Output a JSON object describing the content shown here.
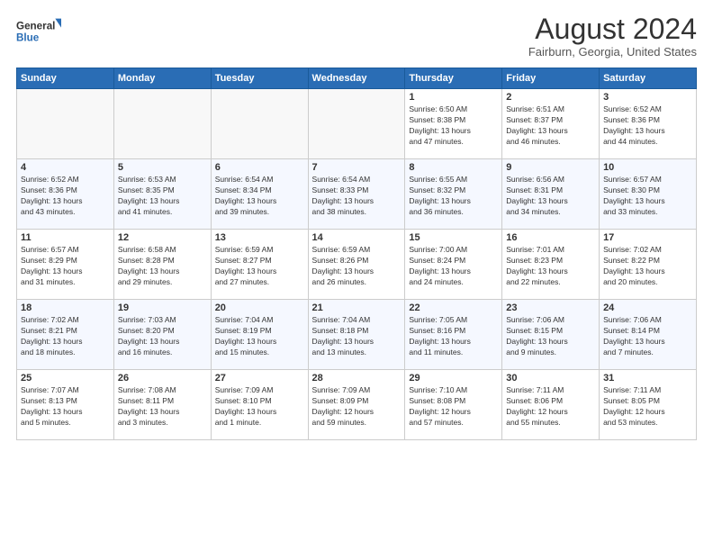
{
  "header": {
    "logo_line1": "General",
    "logo_line2": "Blue",
    "title": "August 2024",
    "subtitle": "Fairburn, Georgia, United States"
  },
  "weekdays": [
    "Sunday",
    "Monday",
    "Tuesday",
    "Wednesday",
    "Thursday",
    "Friday",
    "Saturday"
  ],
  "weeks": [
    [
      {
        "day": "",
        "info": ""
      },
      {
        "day": "",
        "info": ""
      },
      {
        "day": "",
        "info": ""
      },
      {
        "day": "",
        "info": ""
      },
      {
        "day": "1",
        "info": "Sunrise: 6:50 AM\nSunset: 8:38 PM\nDaylight: 13 hours\nand 47 minutes."
      },
      {
        "day": "2",
        "info": "Sunrise: 6:51 AM\nSunset: 8:37 PM\nDaylight: 13 hours\nand 46 minutes."
      },
      {
        "day": "3",
        "info": "Sunrise: 6:52 AM\nSunset: 8:36 PM\nDaylight: 13 hours\nand 44 minutes."
      }
    ],
    [
      {
        "day": "4",
        "info": "Sunrise: 6:52 AM\nSunset: 8:36 PM\nDaylight: 13 hours\nand 43 minutes."
      },
      {
        "day": "5",
        "info": "Sunrise: 6:53 AM\nSunset: 8:35 PM\nDaylight: 13 hours\nand 41 minutes."
      },
      {
        "day": "6",
        "info": "Sunrise: 6:54 AM\nSunset: 8:34 PM\nDaylight: 13 hours\nand 39 minutes."
      },
      {
        "day": "7",
        "info": "Sunrise: 6:54 AM\nSunset: 8:33 PM\nDaylight: 13 hours\nand 38 minutes."
      },
      {
        "day": "8",
        "info": "Sunrise: 6:55 AM\nSunset: 8:32 PM\nDaylight: 13 hours\nand 36 minutes."
      },
      {
        "day": "9",
        "info": "Sunrise: 6:56 AM\nSunset: 8:31 PM\nDaylight: 13 hours\nand 34 minutes."
      },
      {
        "day": "10",
        "info": "Sunrise: 6:57 AM\nSunset: 8:30 PM\nDaylight: 13 hours\nand 33 minutes."
      }
    ],
    [
      {
        "day": "11",
        "info": "Sunrise: 6:57 AM\nSunset: 8:29 PM\nDaylight: 13 hours\nand 31 minutes."
      },
      {
        "day": "12",
        "info": "Sunrise: 6:58 AM\nSunset: 8:28 PM\nDaylight: 13 hours\nand 29 minutes."
      },
      {
        "day": "13",
        "info": "Sunrise: 6:59 AM\nSunset: 8:27 PM\nDaylight: 13 hours\nand 27 minutes."
      },
      {
        "day": "14",
        "info": "Sunrise: 6:59 AM\nSunset: 8:26 PM\nDaylight: 13 hours\nand 26 minutes."
      },
      {
        "day": "15",
        "info": "Sunrise: 7:00 AM\nSunset: 8:24 PM\nDaylight: 13 hours\nand 24 minutes."
      },
      {
        "day": "16",
        "info": "Sunrise: 7:01 AM\nSunset: 8:23 PM\nDaylight: 13 hours\nand 22 minutes."
      },
      {
        "day": "17",
        "info": "Sunrise: 7:02 AM\nSunset: 8:22 PM\nDaylight: 13 hours\nand 20 minutes."
      }
    ],
    [
      {
        "day": "18",
        "info": "Sunrise: 7:02 AM\nSunset: 8:21 PM\nDaylight: 13 hours\nand 18 minutes."
      },
      {
        "day": "19",
        "info": "Sunrise: 7:03 AM\nSunset: 8:20 PM\nDaylight: 13 hours\nand 16 minutes."
      },
      {
        "day": "20",
        "info": "Sunrise: 7:04 AM\nSunset: 8:19 PM\nDaylight: 13 hours\nand 15 minutes."
      },
      {
        "day": "21",
        "info": "Sunrise: 7:04 AM\nSunset: 8:18 PM\nDaylight: 13 hours\nand 13 minutes."
      },
      {
        "day": "22",
        "info": "Sunrise: 7:05 AM\nSunset: 8:16 PM\nDaylight: 13 hours\nand 11 minutes."
      },
      {
        "day": "23",
        "info": "Sunrise: 7:06 AM\nSunset: 8:15 PM\nDaylight: 13 hours\nand 9 minutes."
      },
      {
        "day": "24",
        "info": "Sunrise: 7:06 AM\nSunset: 8:14 PM\nDaylight: 13 hours\nand 7 minutes."
      }
    ],
    [
      {
        "day": "25",
        "info": "Sunrise: 7:07 AM\nSunset: 8:13 PM\nDaylight: 13 hours\nand 5 minutes."
      },
      {
        "day": "26",
        "info": "Sunrise: 7:08 AM\nSunset: 8:11 PM\nDaylight: 13 hours\nand 3 minutes."
      },
      {
        "day": "27",
        "info": "Sunrise: 7:09 AM\nSunset: 8:10 PM\nDaylight: 13 hours\nand 1 minute."
      },
      {
        "day": "28",
        "info": "Sunrise: 7:09 AM\nSunset: 8:09 PM\nDaylight: 12 hours\nand 59 minutes."
      },
      {
        "day": "29",
        "info": "Sunrise: 7:10 AM\nSunset: 8:08 PM\nDaylight: 12 hours\nand 57 minutes."
      },
      {
        "day": "30",
        "info": "Sunrise: 7:11 AM\nSunset: 8:06 PM\nDaylight: 12 hours\nand 55 minutes."
      },
      {
        "day": "31",
        "info": "Sunrise: 7:11 AM\nSunset: 8:05 PM\nDaylight: 12 hours\nand 53 minutes."
      }
    ]
  ]
}
